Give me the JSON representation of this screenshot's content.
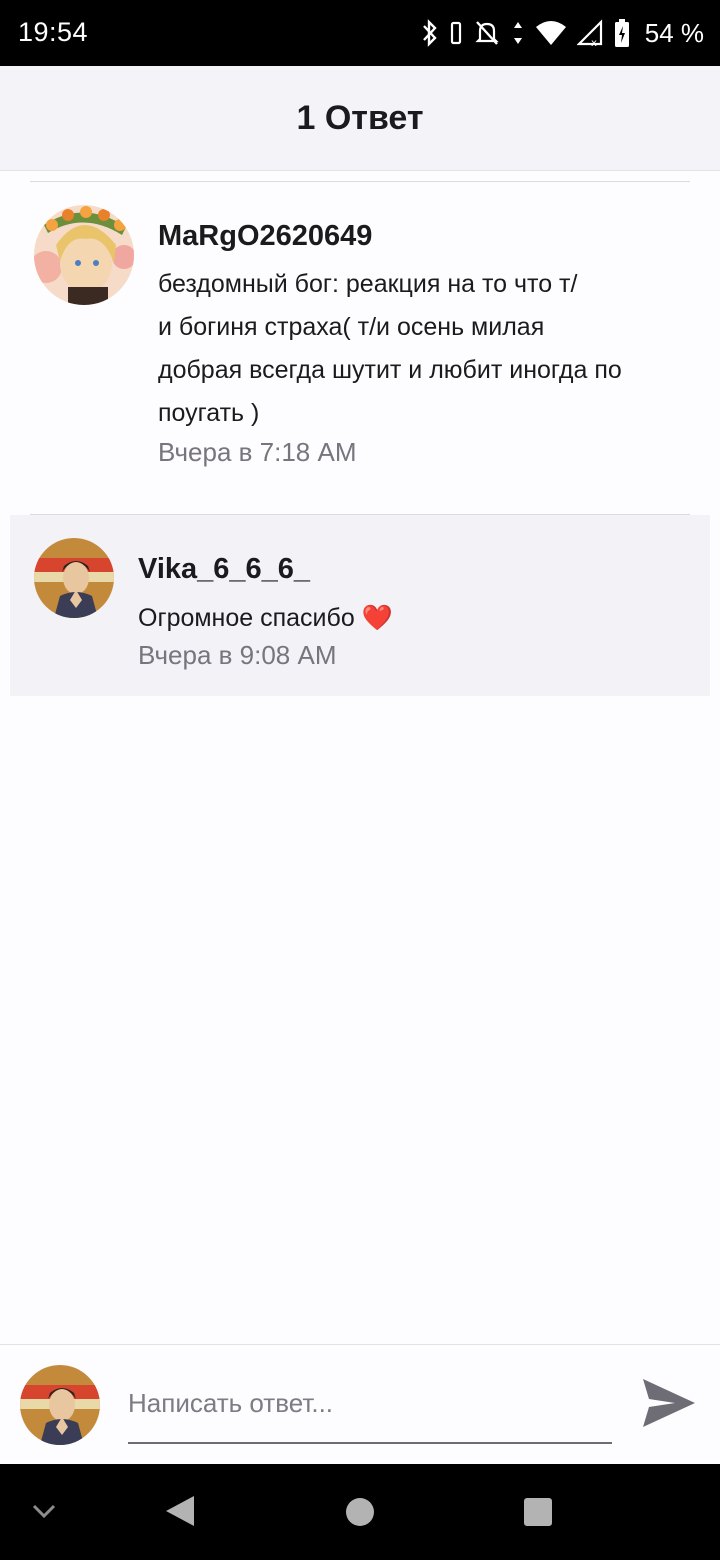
{
  "status_bar": {
    "time": "19:54",
    "battery": "54 %",
    "icons": [
      "bluetooth-icon",
      "vibrate-icon",
      "notifications-off-icon",
      "data-arrows-icon",
      "wifi-icon",
      "cellular-signal-icon",
      "battery-charging-icon"
    ]
  },
  "header": {
    "title": "1 Ответ"
  },
  "comment": {
    "author": "MaRgO2620649",
    "lines": [
      "бездомный бог: реакция на то что т/",
      "и богиня страха( т/и осень милая",
      "добрая всегда шутит и любит иногда по",
      "поугать )"
    ],
    "time": "Вчера в 7:18 AM"
  },
  "reply": {
    "author": "Vika_6_6_6_",
    "text": "Огромное спасибо",
    "emoji": "❤️",
    "time": "Вчера в 9:08 AM"
  },
  "composer": {
    "placeholder": "Написать ответ..."
  },
  "navigation": {
    "buttons": [
      "collapse-icon",
      "back-icon",
      "home-icon",
      "recents-icon"
    ]
  },
  "colors": {
    "accent_heart": "#e0202e",
    "secondary_text": "#77757d",
    "header_bg": "#f4f3f7",
    "reply_bg": "#f3f2f7"
  }
}
